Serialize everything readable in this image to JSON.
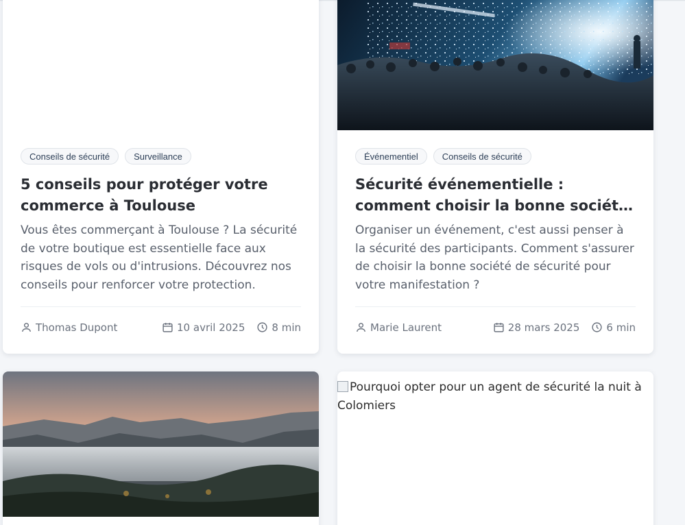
{
  "cards": [
    {
      "image": "",
      "tags": [
        "Conseils de sécurité",
        "Surveillance"
      ],
      "title": "5 conseils pour protéger votre commerce à Toulouse",
      "excerpt": "Vous êtes commerçant à Toulouse ? La sécurité de votre boutique est essentielle face aux risques de vols ou d'intrusions. Découvrez nos conseils pour renforcer votre protection.",
      "author": "Thomas Dupont",
      "date": "10 avril 2025",
      "read_time": "8 min"
    },
    {
      "image": "concert-crowd-photo",
      "tags": [
        "Événementiel",
        "Conseils de sécurité"
      ],
      "title": "Sécurité événementielle : comment choisir la bonne société de sécurité",
      "excerpt": "Organiser un événement, c'est aussi penser à la sécurité des participants. Comment s'assurer de choisir la bonne société de sécurité pour votre manifestation ?",
      "author": "Marie Laurent",
      "date": "28 mars 2025",
      "read_time": "6 min"
    },
    {
      "image": "misty-mountain-landscape-photo"
    },
    {
      "image_alt": "Pourquoi opter pour un agent de sécurité la nuit à Colomiers"
    }
  ],
  "icons": {
    "author": "user-icon",
    "date": "calendar-icon",
    "read_time": "clock-icon"
  },
  "colors": {
    "page_background": "#f4f6f9",
    "card_background": "#ffffff",
    "title": "#2a2d33",
    "text": "#585f6b",
    "tag_border": "#dfe3e8"
  }
}
